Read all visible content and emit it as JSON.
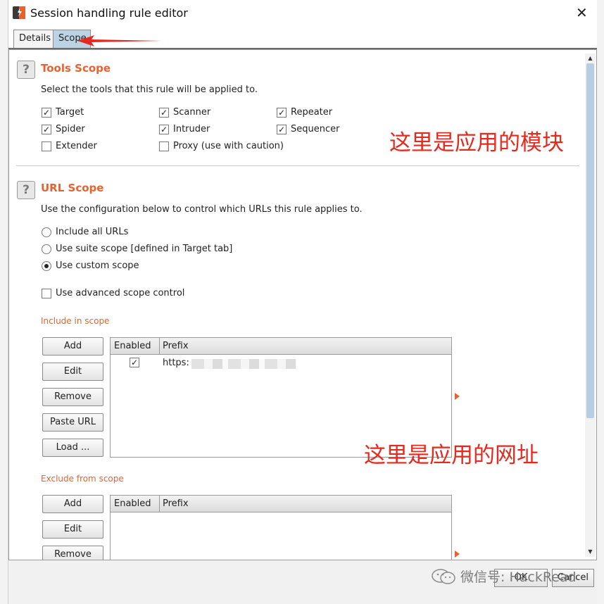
{
  "window": {
    "title": "Session handling rule editor",
    "close_glyph": "✕",
    "icon": "burp-app-icon"
  },
  "tabs": [
    {
      "label": "Details",
      "active": false
    },
    {
      "label": "Scope",
      "active": true
    }
  ],
  "tools_scope": {
    "title": "Tools Scope",
    "help_glyph": "?",
    "description": "Select the tools that this rule will be applied to.",
    "tools": [
      {
        "label": "Target",
        "checked": true
      },
      {
        "label": "Scanner",
        "checked": true
      },
      {
        "label": "Repeater",
        "checked": true
      },
      {
        "label": "Spider",
        "checked": true
      },
      {
        "label": "Intruder",
        "checked": true
      },
      {
        "label": "Sequencer",
        "checked": true
      },
      {
        "label": "Extender",
        "checked": false
      },
      {
        "label": "Proxy (use with caution)",
        "checked": false
      }
    ]
  },
  "url_scope": {
    "title": "URL Scope",
    "help_glyph": "?",
    "description": "Use the configuration below to control which URLs this rule applies to.",
    "options": [
      {
        "label": "Include all URLs",
        "selected": false
      },
      {
        "label": "Use suite scope [defined in Target tab]",
        "selected": false
      },
      {
        "label": "Use custom scope",
        "selected": true
      }
    ],
    "advanced": {
      "label": "Use advanced scope control",
      "checked": false
    }
  },
  "include": {
    "title": "Include in scope",
    "buttons": [
      "Add",
      "Edit",
      "Remove",
      "Paste URL",
      "Load ..."
    ],
    "columns": [
      "Enabled",
      "Prefix"
    ],
    "rows": [
      {
        "enabled": true,
        "prefix": "https:"
      }
    ]
  },
  "exclude": {
    "title": "Exclude from scope",
    "buttons": [
      "Add",
      "Edit",
      "Remove"
    ],
    "columns": [
      "Enabled",
      "Prefix"
    ]
  },
  "annotations": {
    "modules": "这里是应用的模块",
    "urls": "这里是应用的网址"
  },
  "footer": {
    "ok": "OK",
    "cancel": "Cancel"
  },
  "watermark": "微信号: HackRead",
  "colors": {
    "accent_orange": "#e8622f",
    "annotation_red": "#e42a1f",
    "tab_active": "#bcd3e5"
  }
}
